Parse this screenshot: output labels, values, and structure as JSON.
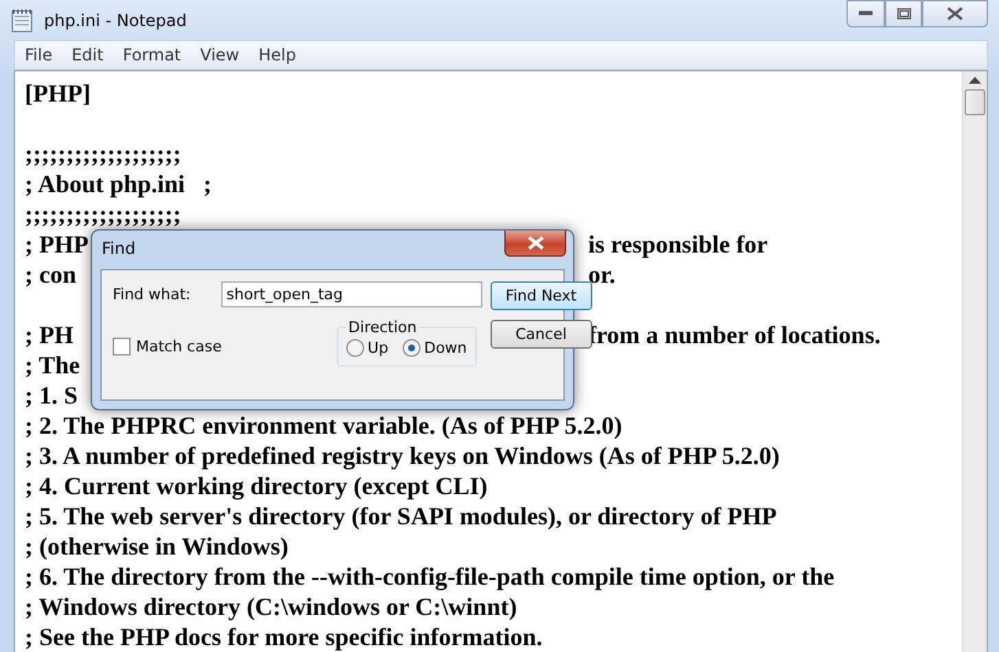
{
  "window": {
    "title": "php.ini - Notepad"
  },
  "menu": [
    "File",
    "Edit",
    "Format",
    "View",
    "Help"
  ],
  "editor": {
    "lines": [
      {
        "kind": "text",
        "left": "[PHP]"
      },
      {
        "kind": "blank"
      },
      {
        "kind": "text",
        "left": ";;;;;;;;;;;;;;;;;;;"
      },
      {
        "kind": "text",
        "left": "; About php.ini   ;"
      },
      {
        "kind": "text",
        "left": ";;;;;;;;;;;;;;;;;;;"
      },
      {
        "kind": "text",
        "left": "; PHP",
        "right": "is responsible for"
      },
      {
        "kind": "text",
        "left": "; con",
        "right": "or."
      },
      {
        "kind": "blank"
      },
      {
        "kind": "text",
        "left": "; PH",
        "right": "from a number of locations."
      },
      {
        "kind": "text",
        "left": "; The"
      },
      {
        "kind": "text",
        "left": "; 1. S"
      },
      {
        "kind": "text",
        "left": "; 2. The PHPRC environment variable. (As of PHP 5.2.0)"
      },
      {
        "kind": "text",
        "left": "; 3. A number of predefined registry keys on Windows (As of PHP 5.2.0)"
      },
      {
        "kind": "text",
        "left": "; 4. Current working directory (except CLI)"
      },
      {
        "kind": "text",
        "left": "; 5. The web server's directory (for SAPI modules), or directory of PHP"
      },
      {
        "kind": "text",
        "left": "; (otherwise in Windows)"
      },
      {
        "kind": "text",
        "left": "; 6. The directory from the --with-config-file-path compile time option, or the"
      },
      {
        "kind": "text",
        "left": "; Windows directory (C:\\windows or C:\\winnt)"
      },
      {
        "kind": "text",
        "left": "; See the PHP docs for more specific information."
      }
    ]
  },
  "find_dialog": {
    "title": "Find",
    "find_what_label": "Find what:",
    "value": "short_open_tag",
    "find_next": "Find Next",
    "cancel": "Cancel",
    "direction_label": "Direction",
    "directions": [
      {
        "label": "Up",
        "selected": false
      },
      {
        "label": "Down",
        "selected": true
      }
    ],
    "match_case": {
      "label": "Match case",
      "checked": false
    }
  }
}
